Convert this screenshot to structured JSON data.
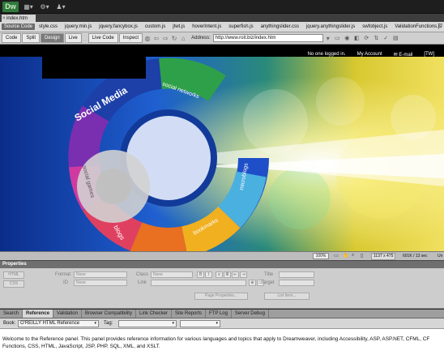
{
  "app": {
    "logo": "Dw",
    "menu_icons": [
      "layout-icon",
      "gear-icon",
      "user-icon"
    ]
  },
  "document_tab": {
    "filename": "index.htm",
    "close_glyph": "×"
  },
  "related_files": {
    "source_label": "Source Code",
    "files": [
      "style.css",
      "jquery.min.js",
      "jquery.fancybox.js",
      "custom.js",
      "jtwt.js",
      "hoverIntent.js",
      "superfish.js",
      "anythingslider.css",
      "jquery.anythingslider.js",
      "swfobject.js",
      "ValidationFunctions.js"
    ]
  },
  "doc_toolbar": {
    "views": [
      "Code",
      "Split",
      "Design",
      "Live"
    ],
    "active_view": "Design",
    "live_code": "Live Code",
    "inspect": "Inspect",
    "address_label": "Address:",
    "address": "http://www.roit.biz/index.htm"
  },
  "site": {
    "nav": [
      "No one logged in.",
      "My Account",
      "✉ E-mail",
      "[TW]"
    ],
    "banner_words": [
      "Social Media",
      "social networks",
      "blogs",
      "social games",
      "microblogs",
      "bookmarks"
    ]
  },
  "status": {
    "zoom": "100%",
    "window_size": "1137 x 475",
    "download": "601K / 13 sec",
    "encoding": "Un"
  },
  "properties": {
    "title": "Properties",
    "html_btn": "HTML",
    "css_btn": "CSS",
    "format_label": "Format",
    "format_value": "None",
    "class_label": "Class",
    "class_value": "None",
    "id_label": "ID",
    "id_value": "None",
    "link_label": "Link",
    "title_label": "Title",
    "target_label": "Target",
    "page_props": "Page Properties...",
    "list_item": "List Item..."
  },
  "panel_tabs": {
    "tabs": [
      "Search",
      "Reference",
      "Validation",
      "Browser Compatibility",
      "Link Checker",
      "Site Reports",
      "FTP Log",
      "Server Debug"
    ],
    "active": "Reference"
  },
  "reference": {
    "book_label": "Book:",
    "book_value": "O'REILLY HTML Reference",
    "tag_label": "Tag:",
    "tag_value": "",
    "content": "Welcome to the Reference panel. This panel provides reference information for various languages and topics that apply to Dreamweaver, including Accessibility, ASP, ASP.NET, CFML, CF Functions, CSS, HTML, JavaScript, JSP, PHP, SQL, XML, and XSLT."
  },
  "colors": {
    "accent": "#2f7a3b",
    "panel_bg": "#cdcdcd",
    "banner_blue": "#1a4fb8"
  }
}
